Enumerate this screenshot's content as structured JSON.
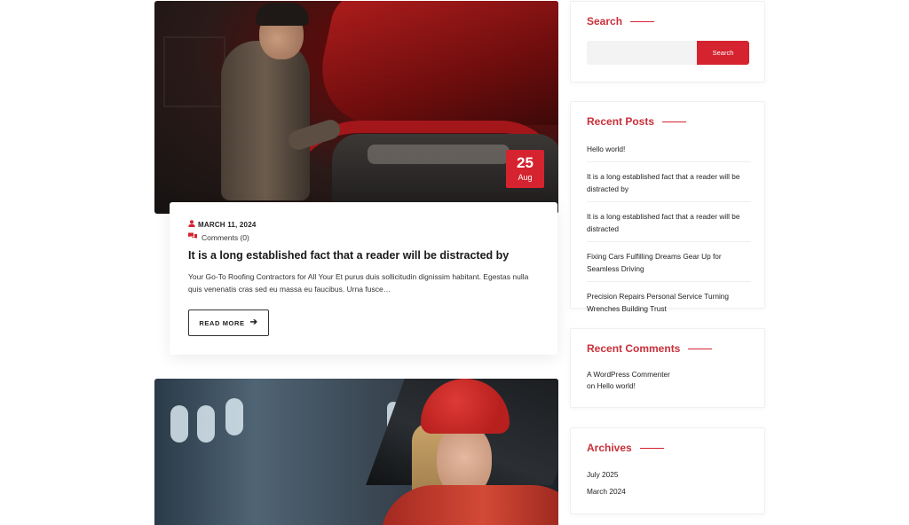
{
  "post1": {
    "date_badge": {
      "day": "25",
      "month": "Aug"
    },
    "meta_date": "MARCH 11, 2024",
    "comments": "Comments (0)",
    "title": "It is a long established fact that a reader will be distracted by",
    "excerpt": "Your Go-To Roofing Contractors for All Your Et purus duis sollicitudin dignissim habitant. Egestas nulla quis venenatis cras sed eu massa eu faucibus. Urna fusce…",
    "read_more": "READ MORE"
  },
  "sidebar": {
    "search": {
      "title": "Search",
      "button": "Search",
      "value": ""
    },
    "recent_posts": {
      "title": "Recent Posts",
      "items": [
        "Hello world!",
        "It is a long established fact that a reader will be distracted by",
        "It is a long established fact that a reader will be distracted",
        "Fixing Cars Fulfilling Dreams Gear Up for Seamless Driving",
        "Precision Repairs Personal Service Turning Wrenches Building Trust"
      ]
    },
    "recent_comments": {
      "title": "Recent Comments",
      "author": "A WordPress Commenter",
      "on": "on",
      "post": "Hello world!"
    },
    "archives": {
      "title": "Archives",
      "items": [
        "July 2025",
        "March 2024"
      ]
    }
  },
  "colors": {
    "accent": "#d5232f",
    "heading_accent": "#c9303a",
    "text": "#222222"
  }
}
